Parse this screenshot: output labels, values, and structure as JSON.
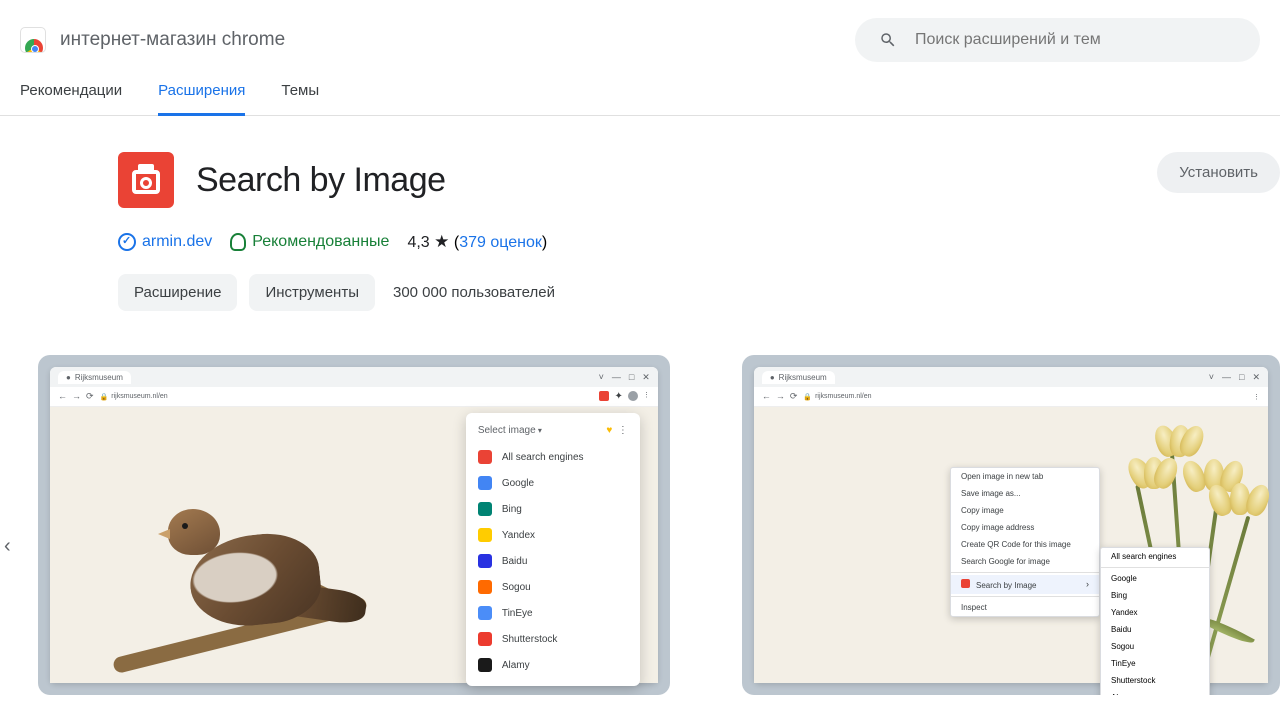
{
  "header": {
    "store_title": "интернет-магазин chrome",
    "search_placeholder": "Поиск расширений и тем"
  },
  "tabs": {
    "recommendations": "Рекомендации",
    "extensions": "Расширения",
    "themes": "Темы"
  },
  "extension": {
    "title": "Search by Image",
    "install_label": "Установить",
    "developer": "armin.dev",
    "recommended_label": "Рекомендованные",
    "rating_value": "4,3",
    "reviews_count": "379 оценок",
    "chip_extension": "Расширение",
    "chip_category": "Инструменты",
    "users_text": "300 000 пользователей"
  },
  "shot1": {
    "tab": "Rijksmuseum",
    "url": "rijksmuseum.nl/en",
    "popup_title": "Select image",
    "heart": "♥",
    "dots": "⋮",
    "engines": [
      {
        "label": "All search engines",
        "color": "#ea4335"
      },
      {
        "label": "Google",
        "color": "#4285f4"
      },
      {
        "label": "Bing",
        "color": "#008373"
      },
      {
        "label": "Yandex",
        "color": "#ffcc00"
      },
      {
        "label": "Baidu",
        "color": "#2932e1"
      },
      {
        "label": "Sogou",
        "color": "#ff6a00"
      },
      {
        "label": "TinEye",
        "color": "#4b8df8"
      },
      {
        "label": "Shutterstock",
        "color": "#ec3b2e"
      },
      {
        "label": "Alamy",
        "color": "#1a1a1a"
      }
    ]
  },
  "shot2": {
    "tab": "Rijksmuseum",
    "url": "rijksmuseum.nl/en",
    "context_items": [
      "Open image in new tab",
      "Save image as...",
      "Copy image",
      "Copy image address",
      "Create QR Code for this image",
      "Search Google for image"
    ],
    "context_highlight": "Search by Image",
    "context_inspect": "Inspect",
    "submenu_top": "All search engines",
    "submenu_items": [
      "Google",
      "Bing",
      "Yandex",
      "Baidu",
      "Sogou",
      "TinEye",
      "Shutterstock",
      "Alamy"
    ]
  }
}
